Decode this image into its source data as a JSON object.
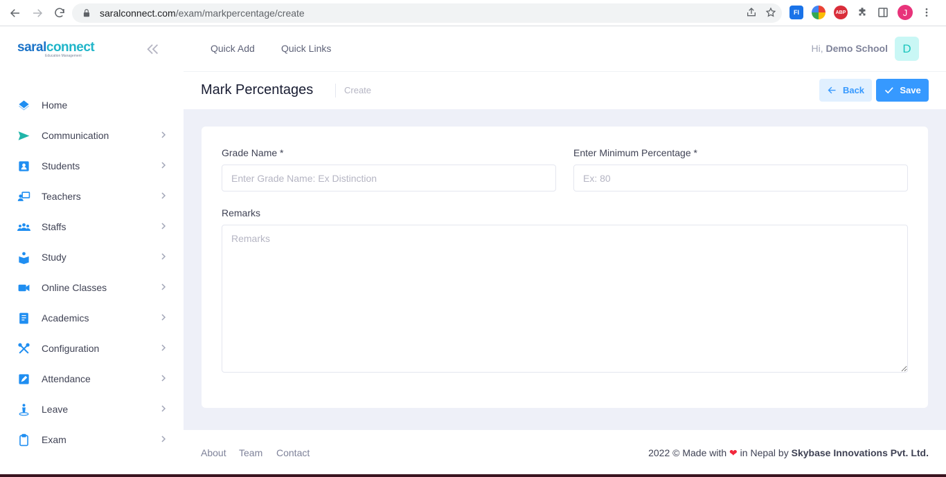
{
  "browser": {
    "url_host": "saralconnect.com",
    "url_path": "/exam/markpercentage/create",
    "profile_initial": "J",
    "extensions": [
      "FI",
      "ABP"
    ]
  },
  "sidebar": {
    "logo_part1": "saral",
    "logo_part2": "connect",
    "logo_tagline": "Education Management",
    "items": [
      {
        "label": "Home",
        "icon": "home-icon",
        "has_chevron": false
      },
      {
        "label": "Communication",
        "icon": "send-icon",
        "has_chevron": true
      },
      {
        "label": "Students",
        "icon": "student-icon",
        "has_chevron": true
      },
      {
        "label": "Teachers",
        "icon": "teacher-icon",
        "has_chevron": true
      },
      {
        "label": "Staffs",
        "icon": "group-icon",
        "has_chevron": true
      },
      {
        "label": "Study",
        "icon": "study-icon",
        "has_chevron": true
      },
      {
        "label": "Online Classes",
        "icon": "video-icon",
        "has_chevron": true
      },
      {
        "label": "Academics",
        "icon": "book-icon",
        "has_chevron": true
      },
      {
        "label": "Configuration",
        "icon": "tools-icon",
        "has_chevron": true
      },
      {
        "label": "Attendance",
        "icon": "edit-icon",
        "has_chevron": true
      },
      {
        "label": "Leave",
        "icon": "person-pin-icon",
        "has_chevron": true
      },
      {
        "label": "Exam",
        "icon": "clipboard-icon",
        "has_chevron": true
      }
    ]
  },
  "header": {
    "quick_add": "Quick Add",
    "quick_links": "Quick Links",
    "greeting_prefix": "Hi,",
    "user_name": "Demo School",
    "avatar_letter": "D"
  },
  "toolbar": {
    "title": "Mark Percentages",
    "breadcrumb": "Create",
    "back_label": "Back",
    "save_label": "Save"
  },
  "form": {
    "grade_name_label": "Grade Name *",
    "grade_name_placeholder": "Enter Grade Name: Ex Distinction",
    "grade_name_value": "",
    "min_pct_label": "Enter Minimum Percentage *",
    "min_pct_placeholder": "Ex: 80",
    "min_pct_value": "",
    "remarks_label": "Remarks",
    "remarks_placeholder": "Remarks",
    "remarks_value": ""
  },
  "footer": {
    "about": "About",
    "team": "Team",
    "contact": "Contact",
    "copyright_prefix": "2022 ©  Made with",
    "copyright_mid": "in Nepal by",
    "company": "Skybase Innovations Pvt. Ltd."
  },
  "colors": {
    "accent": "#3699ff",
    "accent_light": "#e1f0ff",
    "content_bg": "#eef0f8",
    "heart": "#f1273b"
  }
}
